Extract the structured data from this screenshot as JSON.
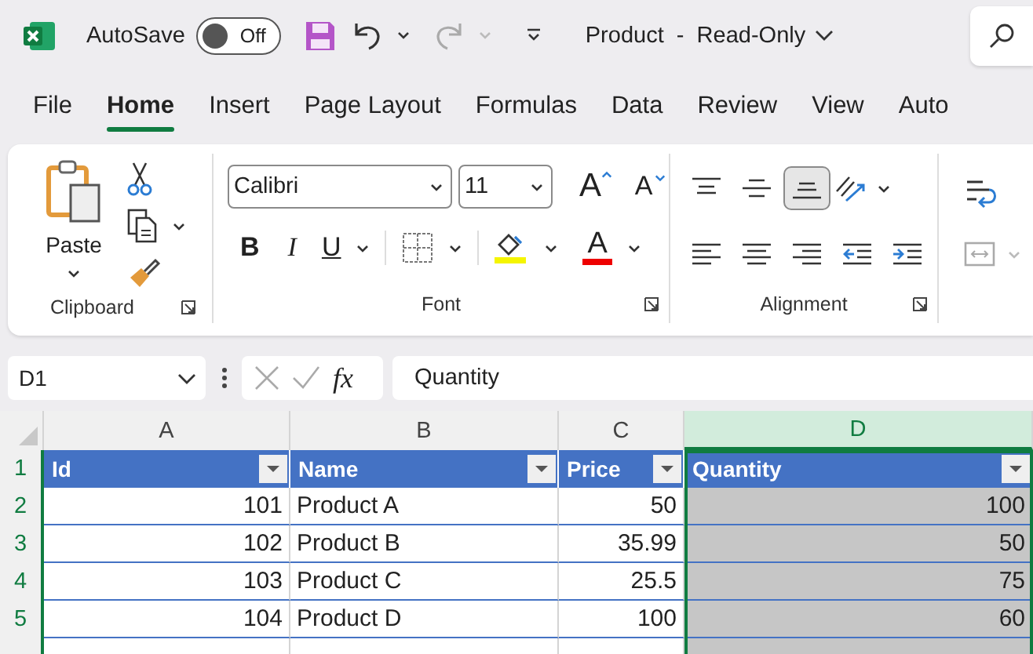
{
  "title_bar": {
    "autosave": {
      "label": "AutoSave",
      "on": false,
      "state_text": "Off"
    },
    "document_title": "Product  -  Read-Only"
  },
  "tabs": [
    {
      "label": "File",
      "selected": false
    },
    {
      "label": "Home",
      "selected": true
    },
    {
      "label": "Insert",
      "selected": false
    },
    {
      "label": "Page Layout",
      "selected": false
    },
    {
      "label": "Formulas",
      "selected": false
    },
    {
      "label": "Data",
      "selected": false
    },
    {
      "label": "Review",
      "selected": false
    },
    {
      "label": "View",
      "selected": false
    },
    {
      "label": "Auto",
      "selected": false
    }
  ],
  "ribbon": {
    "clipboard": {
      "paste_label": "Paste",
      "group_label": "Clipboard"
    },
    "font": {
      "font_name": "Calibri",
      "font_size": "11",
      "grow_label": "A",
      "shrink_label": "A",
      "bold_label": "B",
      "italic_label": "I",
      "underline_label": "U",
      "font_color_label": "A",
      "group_label": "Font"
    },
    "alignment": {
      "group_label": "Alignment",
      "buttons": [
        {
          "kind": "top",
          "selected": false
        },
        {
          "kind": "middle",
          "selected": false
        },
        {
          "kind": "bottom",
          "selected": true
        },
        {
          "kind": "left",
          "selected": false
        },
        {
          "kind": "center",
          "selected": false
        },
        {
          "kind": "right",
          "selected": false
        },
        {
          "kind": "outdent",
          "selected": false
        },
        {
          "kind": "indent",
          "selected": false
        }
      ]
    }
  },
  "formula_bar": {
    "name_box": "D1",
    "fx_label": "fx",
    "formula": "Quantity"
  },
  "sheet": {
    "columns": [
      {
        "letter": "A",
        "selected": false
      },
      {
        "letter": "B",
        "selected": false
      },
      {
        "letter": "C",
        "selected": false
      },
      {
        "letter": "D",
        "selected": true
      }
    ],
    "row_numbers": [
      "1",
      "2",
      "3",
      "4",
      "5"
    ],
    "header": [
      "Id",
      "Name",
      "Price",
      "Quantity"
    ],
    "rows": [
      [
        "101",
        "Product A",
        "50",
        "100"
      ],
      [
        "102",
        "Product B",
        "35.99",
        "50"
      ],
      [
        "103",
        "Product C",
        "25.5",
        "75"
      ],
      [
        "104",
        "Product D",
        "100",
        "60"
      ]
    ]
  }
}
